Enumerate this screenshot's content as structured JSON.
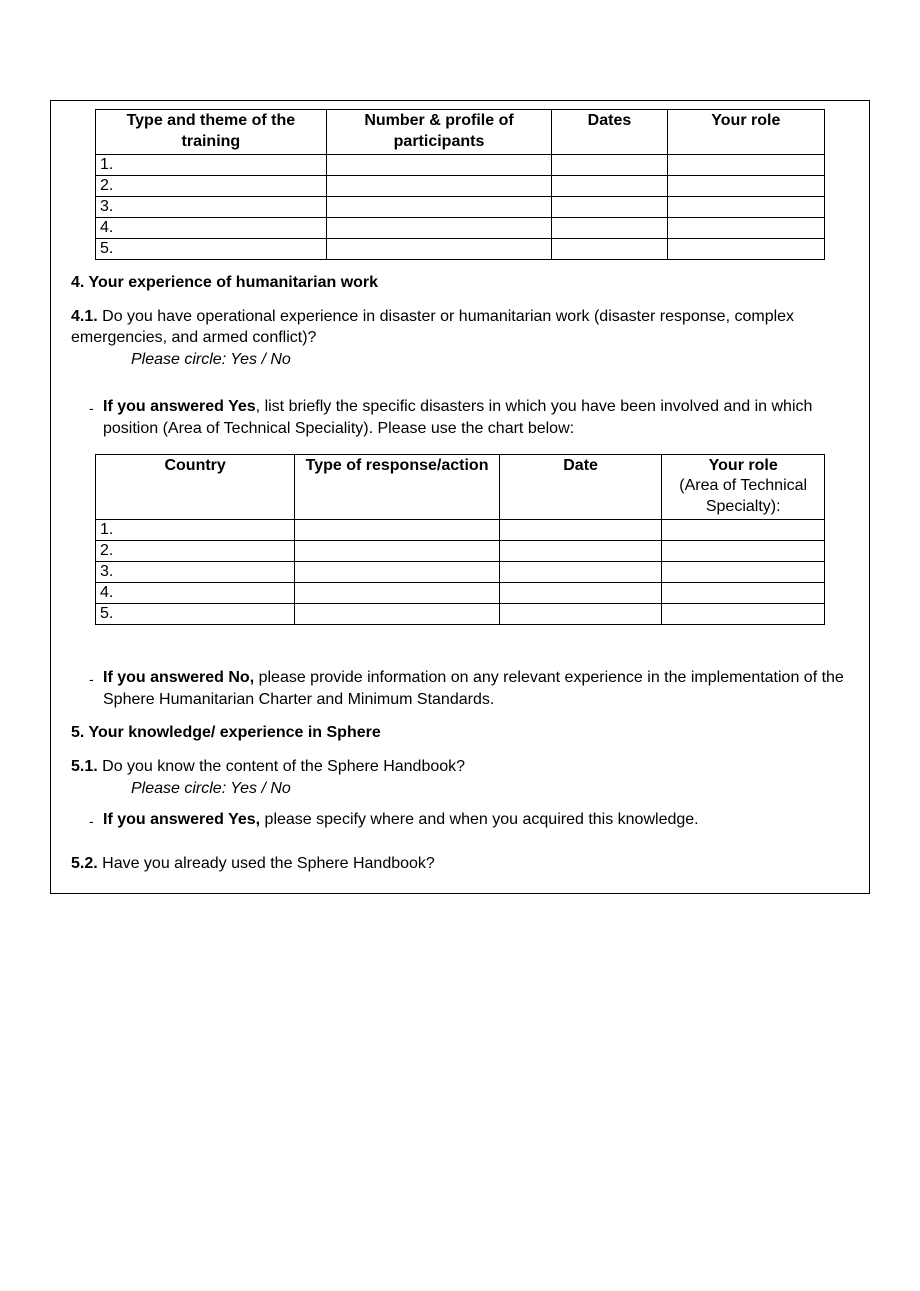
{
  "table1": {
    "headers": {
      "col1": "Type and theme of the training",
      "col2": "Number & profile of participants",
      "col3": "Dates",
      "col4": "Your role"
    },
    "rows": [
      "1.",
      "2.",
      "3.",
      "4.",
      "5."
    ]
  },
  "section4": {
    "heading": "4. Your experience of humanitarian work",
    "q41_num": "4.1.",
    "q41_text": " Do you have operational experience in disaster or humanitarian work (disaster response, complex emergencies, and armed conflict)?",
    "q41_circle": "Please circle: Yes / No",
    "yes_bold": "If you answered Yes",
    "yes_rest": ", list briefly the specific disasters in which you have been involved and in which position (Area of Technical Speciality). Please use the chart below:",
    "no_bold": "If you answered No,",
    "no_rest": " please provide information on any relevant experience in the implementation of the Sphere Humanitarian Charter and Minimum Standards."
  },
  "table2": {
    "headers": {
      "col1": "Country",
      "col2": "Type of response/action",
      "col3": "Date",
      "col4_bold": "Your role",
      "col4_sub": "(Area of Technical Specialty):"
    },
    "rows": [
      "1.",
      "2.",
      "3.",
      "4.",
      "5."
    ]
  },
  "section5": {
    "heading": "5. Your knowledge/ experience in Sphere",
    "q51_num": "5.1.",
    "q51_text": " Do you know the content of the Sphere Handbook?",
    "q51_circle": "Please circle: Yes / No",
    "yes_bold": "If you answered Yes,",
    "yes_rest": " please specify where and when you acquired this knowledge.",
    "q52_num": "5.2.",
    "q52_text": " Have you already used the Sphere Handbook?"
  }
}
